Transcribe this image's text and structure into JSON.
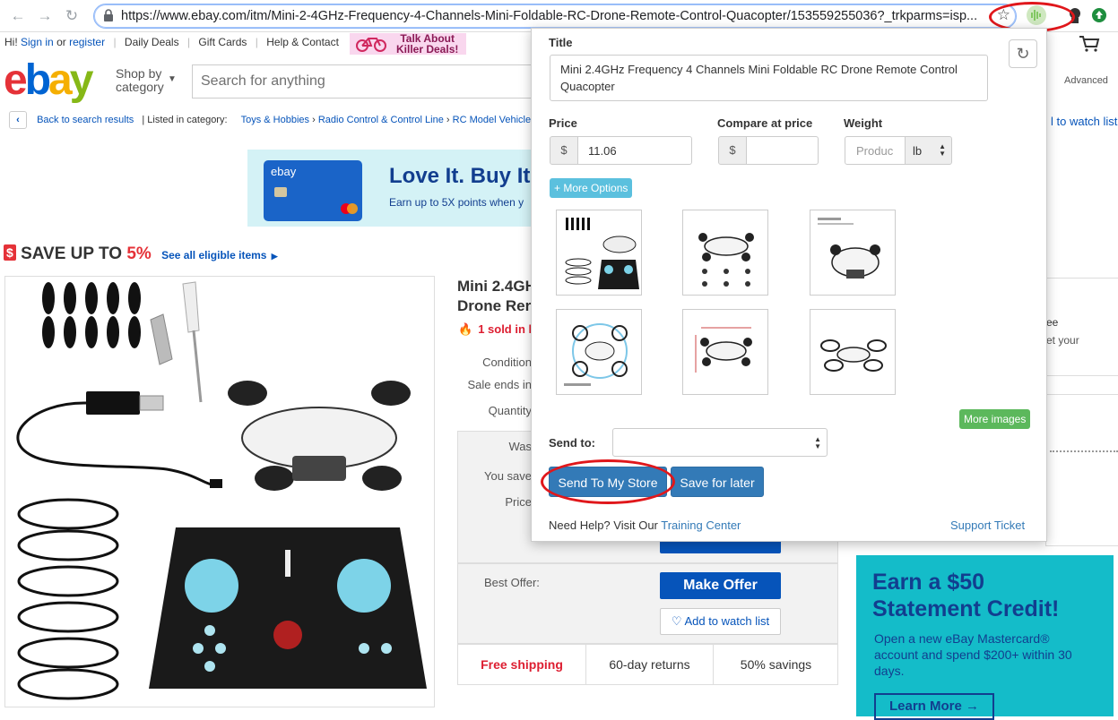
{
  "browser": {
    "url": "https://www.ebay.com/itm/Mini-2-4GHz-Frequency-4-Channels-Mini-Foldable-RC-Drone-Remote-Control-Quacopter/153559255036?_trkparms=isp..."
  },
  "topnav": {
    "greeting": "Hi!",
    "sign_in": "Sign in",
    "or": "or",
    "register": "register",
    "daily_deals": "Daily Deals",
    "gift_cards": "Gift Cards",
    "help_contact": "Help & Contact",
    "promo_line1": "Talk About",
    "promo_line2": "Killer Deals!"
  },
  "header": {
    "logo": [
      "e",
      "b",
      "a",
      "y"
    ],
    "shop_by_line1": "Shop by",
    "shop_by_line2": "category",
    "search_placeholder": "Search for anything",
    "advanced": "Advanced"
  },
  "breadcrumb": {
    "back": "Back to search results",
    "listed_in": "| Listed in category:",
    "items": [
      "Toys & Hobbies",
      "Radio Control & Control Line",
      "RC Model Vehicle"
    ],
    "watch": "l to watch list"
  },
  "ad": {
    "card_brand": "ebay",
    "headline": "Love It. Buy It.",
    "sub": "Earn up to 5X points when y"
  },
  "savings": {
    "prefix": "SAVE UP TO",
    "percent": "5%",
    "link": "See all eligible items"
  },
  "product": {
    "title_line1": "Mini 2.4GH",
    "title_line2": "Drone Rer",
    "sold": "1 sold in la",
    "labels": [
      "Condition",
      "Sale ends in",
      "Quantity",
      "Was",
      "You save",
      "Price"
    ],
    "best_offer_label": "Best Offer:",
    "make_offer": "Make Offer",
    "add_to_watch": "Add to watch list",
    "free_shipping": "Free shipping",
    "returns": "60-day returns",
    "savings": "50% savings"
  },
  "right": {
    "box1_line1": "ee",
    "box1_line2": "et your",
    "mc_headline_line1": "Earn a $50",
    "mc_headline_line2": "Statement Credit!",
    "mc_body": "Open a new eBay Mastercard® account and spend $200+ within 30 days.",
    "mc_button": "Learn More"
  },
  "popup": {
    "title_label": "Title",
    "title_value": "Mini 2.4GHz Frequency 4 Channels Mini Foldable RC Drone Remote Control Quacopter",
    "price_label": "Price",
    "currency": "$",
    "price_value": "11.06",
    "compare_label": "Compare at price",
    "compare_value": "",
    "weight_label": "Weight",
    "weight_placeholder": "Produc",
    "weight_unit": "lb",
    "more_options": "+ More Options",
    "more_images": "More images",
    "send_to_label": "Send to:",
    "send_to_value": "",
    "send_button": "Send To My Store",
    "save_button": "Save for later",
    "help_text": "Need Help? Visit Our",
    "training_link": "Training Center",
    "support_link": "Support Ticket"
  },
  "colors": {
    "ebay_red": "#e53238",
    "ebay_blue": "#0064d2",
    "ebay_yellow": "#f5af02",
    "ebay_green": "#86b817",
    "popup_primary": "#337ab7",
    "annotation_red": "#e0171b"
  }
}
